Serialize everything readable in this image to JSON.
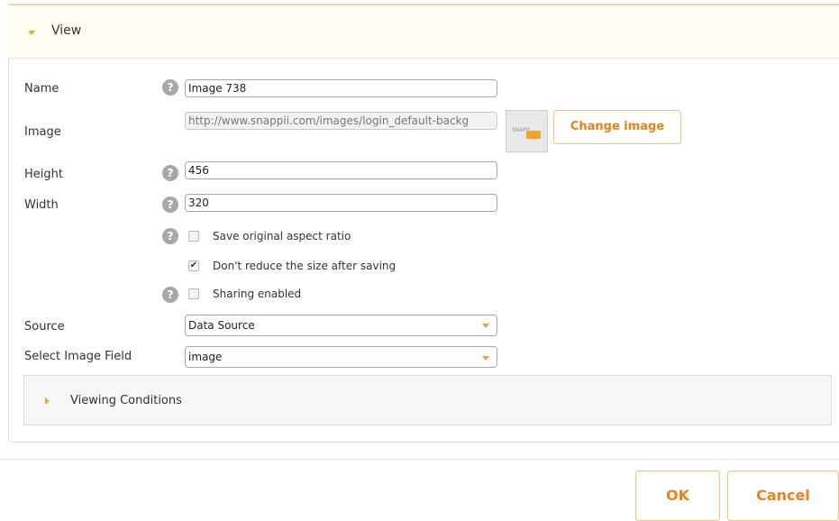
{
  "view_section": {
    "title": "View"
  },
  "form": {
    "name": {
      "label": "Name",
      "value": "Image 738"
    },
    "image": {
      "label": "Image",
      "value": "http://www.snappii.com/images/login_default-backg",
      "thumbnail_text": "SNAPP",
      "change_button": "Change image"
    },
    "height": {
      "label": "Height",
      "value": "456"
    },
    "width": {
      "label": "Width",
      "value": "320"
    },
    "checkboxes": [
      {
        "label": "Save original aspect ratio",
        "checked": false
      },
      {
        "label": "Don't reduce the size after saving",
        "checked": true
      },
      {
        "label": "Sharing enabled",
        "checked": false
      }
    ],
    "source": {
      "label": "Source",
      "value": "Data Source"
    },
    "image_field": {
      "label": "Select Image Field",
      "value": "image"
    }
  },
  "viewing_conditions": {
    "title": "Viewing Conditions"
  },
  "footer": {
    "ok": "OK",
    "cancel": "Cancel"
  },
  "colors": {
    "accent": "#ee7f1b",
    "caret": "#f0a528",
    "header_bg": "#fffdf4"
  },
  "icons": {
    "help": "help-icon",
    "expanded": "caret-down-icon",
    "collapsed": "caret-right-icon"
  }
}
